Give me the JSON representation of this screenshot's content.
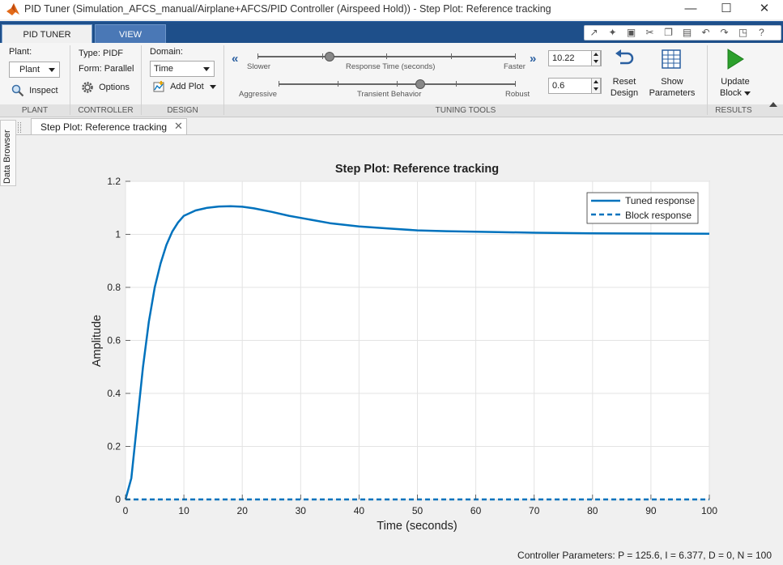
{
  "window": {
    "title": "PID Tuner (Simulation_AFCS_manual/Airplane+AFCS/PID Controller (Airspeed Hold)) - Step Plot: Reference tracking",
    "controls": [
      "minimize-icon",
      "maximize-icon",
      "close-icon"
    ]
  },
  "tabs": [
    {
      "label": "PID TUNER",
      "active": true
    },
    {
      "label": "VIEW",
      "active": false
    }
  ],
  "quick_access_icons": [
    "undock-icon",
    "new-figure-icon",
    "save-icon",
    "cut-icon",
    "copy-icon",
    "paste-icon",
    "undo-icon",
    "redo-icon",
    "window-icon",
    "help-icon"
  ],
  "plant": {
    "label": "Plant:",
    "value": "Plant",
    "inspect_label": "Inspect",
    "section": "PLANT"
  },
  "controller": {
    "type_label": "Type: PIDF",
    "form_label": "Form: Parallel",
    "options_label": "Options",
    "section": "CONTROLLER"
  },
  "design": {
    "domain_label": "Domain:",
    "domain_value": "Time",
    "add_plot_label": "Add Plot",
    "section": "DESIGN"
  },
  "tuning": {
    "response_slider": {
      "left": "Slower",
      "center": "Response Time (seconds)",
      "right": "Faster",
      "value": "10.22",
      "position": 0.28
    },
    "behavior_slider": {
      "left": "Aggressive",
      "center": "Transient Behavior",
      "right": "Robust",
      "value": "0.6",
      "position": 0.6
    },
    "reset_label_1": "Reset",
    "reset_label_2": "Design",
    "show_label_1": "Show",
    "show_label_2": "Parameters",
    "section": "TUNING TOOLS"
  },
  "results": {
    "update_label_1": "Update",
    "update_label_2": "Block",
    "section": "RESULTS"
  },
  "side_panel": {
    "label": "Data Browser"
  },
  "document_tab": {
    "label": "Step Plot: Reference tracking"
  },
  "colors": {
    "tuned": "#0072BD",
    "block": "#0072BD",
    "tab_blue": "#1e4f8a",
    "play_green": "#2ca02c"
  },
  "chart_data": {
    "type": "line",
    "title": "Step Plot: Reference tracking",
    "xlabel": "Time (seconds)",
    "ylabel": "Amplitude",
    "xlim": [
      0,
      100
    ],
    "ylim": [
      0,
      1.2
    ],
    "xticks": [
      0,
      10,
      20,
      30,
      40,
      50,
      60,
      70,
      80,
      90,
      100
    ],
    "yticks": [
      0,
      0.2,
      0.4,
      0.6,
      0.8,
      1,
      1.2
    ],
    "xtick_labels": [
      "0",
      "10",
      "20",
      "30",
      "40",
      "50",
      "60",
      "70",
      "80",
      "90",
      "100"
    ],
    "ytick_labels": [
      "0",
      "0.2",
      "0.4",
      "0.6",
      "0.8",
      "1",
      "1.2"
    ],
    "grid": true,
    "legend_position": "top-right",
    "series": [
      {
        "name": "Tuned response",
        "style": "solid",
        "x": [
          0,
          1,
          2,
          3,
          4,
          5,
          6,
          7,
          8,
          9,
          10,
          12,
          14,
          16,
          18,
          20,
          22,
          25,
          28,
          30,
          35,
          40,
          45,
          50,
          55,
          60,
          70,
          80,
          90,
          100
        ],
        "y": [
          0,
          0.08,
          0.29,
          0.5,
          0.67,
          0.8,
          0.89,
          0.96,
          1.01,
          1.045,
          1.07,
          1.09,
          1.1,
          1.105,
          1.106,
          1.104,
          1.098,
          1.085,
          1.07,
          1.062,
          1.042,
          1.03,
          1.022,
          1.015,
          1.012,
          1.01,
          1.006,
          1.004,
          1.003,
          1.002
        ]
      },
      {
        "name": "Block response",
        "style": "dashed",
        "x": [
          0,
          100
        ],
        "y": [
          0,
          0
        ]
      }
    ]
  },
  "status": {
    "text": "Controller Parameters: P = 125.6, I = 6.377, D =  0, N = 100"
  }
}
